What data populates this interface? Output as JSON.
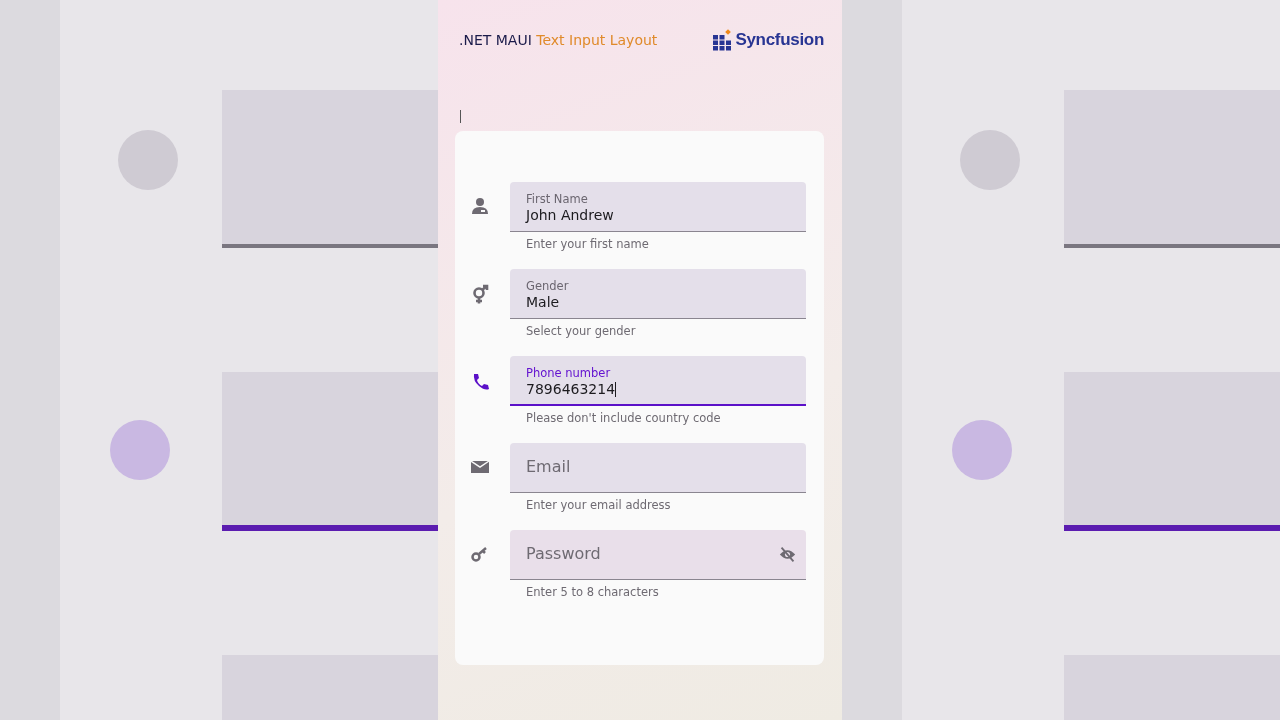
{
  "header": {
    "title_prefix": ".NET MAUI",
    "title_highlight": "Text Input Layout",
    "logo": "Syncfusion"
  },
  "fields": [
    {
      "kind": "text",
      "label": "First Name",
      "value": "John Andrew",
      "helper": "Enter your first name",
      "focused": false
    },
    {
      "kind": "text",
      "label": "Gender",
      "value": "Male",
      "helper": "Select your gender",
      "focused": false
    },
    {
      "kind": "text",
      "label": "Phone number",
      "value": "7896463214",
      "helper": "Please don't include country code",
      "focused": true
    },
    {
      "kind": "text",
      "placeholder": "Email",
      "helper": "Enter your email address",
      "focused": false
    },
    {
      "kind": "password",
      "placeholder": "Password",
      "helper": "Enter 5 to 8 characters",
      "focused": false
    }
  ]
}
